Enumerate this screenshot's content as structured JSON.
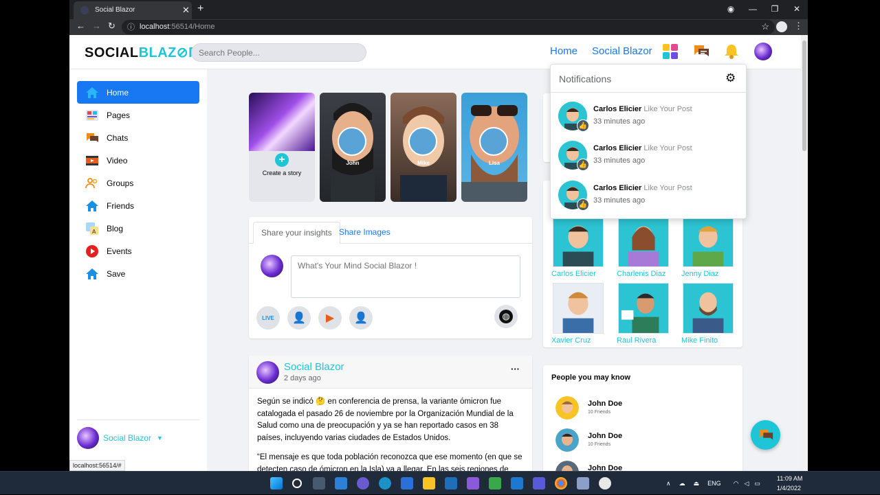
{
  "browser": {
    "tab_title": "Social Blazor",
    "url_host": "localhost",
    "url_rest": ":56514/Home",
    "status_url": "localhost:56514/#"
  },
  "brand": {
    "logo_prefix": "SOCIAL",
    "logo_blazor": "BLAZ",
    "logo_o": "⊘",
    "logo_end": "R"
  },
  "search": {
    "placeholder": "Search People..."
  },
  "topnav": {
    "home": "Home",
    "social_blazor": "Social Blazor"
  },
  "sidebar": {
    "items": [
      {
        "label": "Home",
        "icon": "home-icon"
      },
      {
        "label": "Pages",
        "icon": "pages-icon"
      },
      {
        "label": "Chats",
        "icon": "chats-icon"
      },
      {
        "label": "Video",
        "icon": "video-icon"
      },
      {
        "label": "Groups",
        "icon": "groups-icon"
      },
      {
        "label": "Friends",
        "icon": "friends-icon"
      },
      {
        "label": "Blog",
        "icon": "blog-icon"
      },
      {
        "label": "Events",
        "icon": "events-icon"
      },
      {
        "label": "Save",
        "icon": "save-icon"
      }
    ],
    "user_name": "Social Blazor"
  },
  "stories": {
    "create_label": "Create a story",
    "items": [
      {
        "name": "John"
      },
      {
        "name": "Mike"
      },
      {
        "name": "Lisa"
      }
    ]
  },
  "composer": {
    "tab_insights": "Share your insights",
    "tab_images": "Share Images",
    "placeholder": "What's Your Mind Social Blazor !"
  },
  "post": {
    "author": "Social Blazor",
    "time": "2 days ago",
    "more": "···",
    "p1": "Según se indicó 🤔 en conferencia de prensa, la variante ómicron fue catalogada el pasado 26 de noviembre por la Organización Mundial de la Salud como una de preocupación y ya se han reportado casos en 38 países, incluyendo varias ciudades de Estados Unidos.",
    "p2": "“El mensaje es que toda población reconozca que ese momento (en que se detecten caso de ómicron en la Isla) va a llegar. En las seis regiones de salud"
  },
  "friends": [
    {
      "name": "Carlos Elicier"
    },
    {
      "name": "Charlenis Diaz"
    },
    {
      "name": "Jenny Diaz"
    },
    {
      "name": "Xavier Cruz"
    },
    {
      "name": "Raul Rivera"
    },
    {
      "name": "Mike Finito"
    }
  ],
  "pymk": {
    "title": "People you may know",
    "items": [
      {
        "name": "John Doe",
        "sub": "10 Friends"
      },
      {
        "name": "John Doe",
        "sub": "10 Friends"
      },
      {
        "name": "John Doe",
        "sub": ""
      }
    ]
  },
  "notifications": {
    "title": "Notifications",
    "items": [
      {
        "name": "Carlos Elicier",
        "action": "Like Your Post",
        "time": "33 minutes ago"
      },
      {
        "name": "Carlos Elicier",
        "action": "Like Your Post",
        "time": "33 minutes ago"
      },
      {
        "name": "Carlos Elicier",
        "action": "Like Your Post",
        "time": "33 minutes ago"
      }
    ]
  },
  "taskbar": {
    "lang": "ENG",
    "time": "11:09 AM",
    "date": "1/4/2022"
  }
}
